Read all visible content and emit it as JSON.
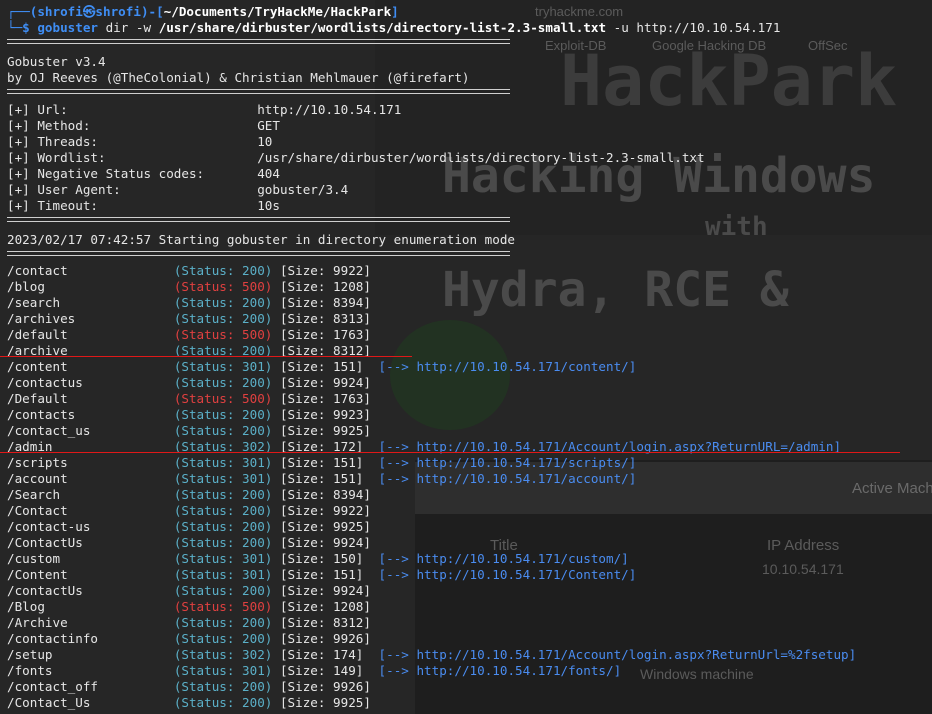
{
  "background": {
    "browser_tab": "tryhackme.com",
    "bookmarks": [
      "Exploit-DB",
      "Google Hacking DB",
      "OffSec"
    ],
    "art_lines": [
      "HackPark",
      "Hacking Windows",
      "with",
      "Hydra, RCE &"
    ],
    "panel_title": "Active Machine",
    "col_title": "Title",
    "col_ip": "IP Address",
    "ip_value": "10.10.54.171",
    "footer": "Windows machine"
  },
  "prompt": {
    "open": "┌──(",
    "user": "shrofi㉿shrofi",
    "mid": ")-[",
    "path": "~/Documents/TryHackMe/HackPark",
    "close": "]",
    "arrow": "└─$ ",
    "cmd": "gobuster",
    "args1": " dir -w ",
    "wordlist_arg": "/usr/share/dirbuster/wordlists/directory-list-2.3-small.txt",
    "args2": " -u http://10.10.54.171"
  },
  "banner": {
    "version": "Gobuster v3.4",
    "authors": "by OJ Reeves (@TheColonial) & Christian Mehlmauer (@firefart)"
  },
  "config": [
    {
      "key": "[+] Url:",
      "value": "http://10.10.54.171"
    },
    {
      "key": "[+] Method:",
      "value": "GET"
    },
    {
      "key": "[+] Threads:",
      "value": "10"
    },
    {
      "key": "[+] Wordlist:",
      "value": "/usr/share/dirbuster/wordlists/directory-list-2.3-small.txt"
    },
    {
      "key": "[+] Negative Status codes:",
      "value": "404"
    },
    {
      "key": "[+] User Agent:",
      "value": "gobuster/3.4"
    },
    {
      "key": "[+] Timeout:",
      "value": "10s"
    }
  ],
  "start_msg": "2023/02/17 07:42:57 Starting gobuster in directory enumeration mode",
  "results": [
    {
      "path": "/contact",
      "status": "200",
      "size": "9922",
      "redirect": ""
    },
    {
      "path": "/blog",
      "status": "500",
      "size": "1208",
      "redirect": ""
    },
    {
      "path": "/search",
      "status": "200",
      "size": "8394",
      "redirect": ""
    },
    {
      "path": "/archives",
      "status": "200",
      "size": "8313",
      "redirect": ""
    },
    {
      "path": "/default",
      "status": "500",
      "size": "1763",
      "redirect": ""
    },
    {
      "path": "/archive",
      "status": "200",
      "size": "8312",
      "redirect": ""
    },
    {
      "path": "/content",
      "status": "301",
      "size": "151",
      "redirect": "http://10.10.54.171/content/"
    },
    {
      "path": "/contactus",
      "status": "200",
      "size": "9924",
      "redirect": ""
    },
    {
      "path": "/Default",
      "status": "500",
      "size": "1763",
      "redirect": ""
    },
    {
      "path": "/contacts",
      "status": "200",
      "size": "9923",
      "redirect": ""
    },
    {
      "path": "/contact_us",
      "status": "200",
      "size": "9925",
      "redirect": ""
    },
    {
      "path": "/admin",
      "status": "302",
      "size": "172",
      "redirect": "http://10.10.54.171/Account/login.aspx?ReturnURL=/admin"
    },
    {
      "path": "/scripts",
      "status": "301",
      "size": "151",
      "redirect": "http://10.10.54.171/scripts/"
    },
    {
      "path": "/account",
      "status": "301",
      "size": "151",
      "redirect": "http://10.10.54.171/account/"
    },
    {
      "path": "/Search",
      "status": "200",
      "size": "8394",
      "redirect": ""
    },
    {
      "path": "/Contact",
      "status": "200",
      "size": "9922",
      "redirect": ""
    },
    {
      "path": "/contact-us",
      "status": "200",
      "size": "9925",
      "redirect": ""
    },
    {
      "path": "/ContactUs",
      "status": "200",
      "size": "9924",
      "redirect": ""
    },
    {
      "path": "/custom",
      "status": "301",
      "size": "150",
      "redirect": "http://10.10.54.171/custom/"
    },
    {
      "path": "/Content",
      "status": "301",
      "size": "151",
      "redirect": "http://10.10.54.171/Content/"
    },
    {
      "path": "/contactUs",
      "status": "200",
      "size": "9924",
      "redirect": ""
    },
    {
      "path": "/Blog",
      "status": "500",
      "size": "1208",
      "redirect": ""
    },
    {
      "path": "/Archive",
      "status": "200",
      "size": "8312",
      "redirect": ""
    },
    {
      "path": "/contactinfo",
      "status": "200",
      "size": "9926",
      "redirect": ""
    },
    {
      "path": "/setup",
      "status": "302",
      "size": "174",
      "redirect": "http://10.10.54.171/Account/login.aspx?ReturnUrl=%2fsetup"
    },
    {
      "path": "/fonts",
      "status": "301",
      "size": "149",
      "redirect": "http://10.10.54.171/fonts/"
    },
    {
      "path": "/contact_off",
      "status": "200",
      "size": "9926",
      "redirect": ""
    },
    {
      "path": "/Contact_Us",
      "status": "200",
      "size": "9925",
      "redirect": ""
    }
  ],
  "colors": {
    "status_ok": "#5bb0c8",
    "status_error": "#e04040",
    "link": "#4a8cf0",
    "prompt": "#3f8ef5",
    "highlight": "#e01818"
  }
}
